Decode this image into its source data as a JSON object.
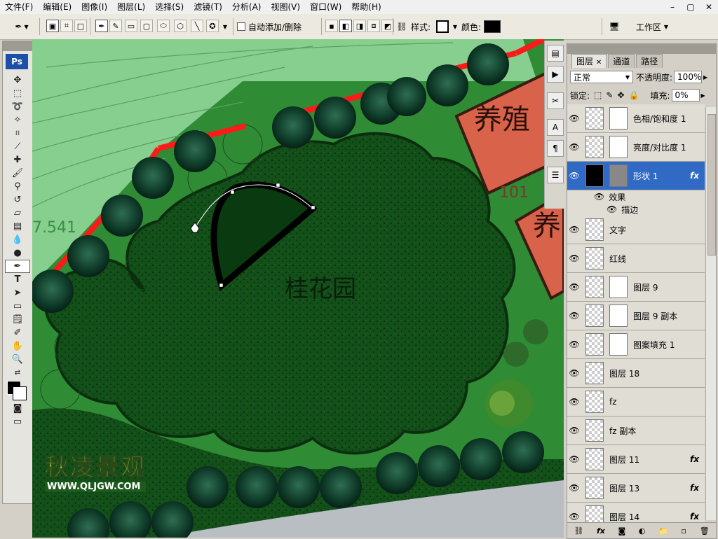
{
  "menubar": {
    "items": [
      "文件(F)",
      "编辑(E)",
      "图像(I)",
      "图层(L)",
      "选择(S)",
      "滤镜(T)",
      "分析(A)",
      "视图(V)",
      "窗口(W)",
      "帮助(H)"
    ],
    "window_controls": [
      "–",
      "▢",
      "✕"
    ]
  },
  "options": {
    "auto_add_delete_label": "自动添加/删除",
    "style_label": "样式:",
    "color_label": "颜色:",
    "workspace_label": "工作区",
    "color_value": "#000000"
  },
  "toolbox": {
    "logo": "Ps"
  },
  "canvas": {
    "title_text": "桂花园",
    "label_right_top": "养殖",
    "label_right_mid": "养",
    "num_left": "7.541",
    "num_right": "101"
  },
  "watermark": {
    "brand": "秋凌景观",
    "url": "WWW.QLJGW.COM"
  },
  "layers_panel": {
    "tabs": [
      "图层",
      "通道",
      "路径"
    ],
    "blend_mode": "正常",
    "opacity_label": "不透明度:",
    "opacity_value": "100%",
    "lock_label": "锁定:",
    "fill_label": "填充:",
    "fill_value": "0%",
    "effects_label": "效果",
    "stroke_label": "描边",
    "fx_label": "fx",
    "layers": [
      {
        "name": "色相/饱和度 1",
        "thumb": "adj",
        "mask": true,
        "fx": false,
        "selected": false
      },
      {
        "name": "亮度/对比度 1",
        "thumb": "adj",
        "mask": true,
        "fx": false,
        "selected": false
      },
      {
        "name": "形状 1",
        "thumb": "dark",
        "mask": true,
        "fx": true,
        "selected": true
      },
      {
        "name": "文字",
        "thumb": "check",
        "mask": false,
        "fx": false,
        "selected": false
      },
      {
        "name": "红线",
        "thumb": "check",
        "mask": false,
        "fx": false,
        "selected": false
      },
      {
        "name": "图层 9",
        "thumb": "check",
        "mask": true,
        "fx": false,
        "selected": false
      },
      {
        "name": "图层 9 副本",
        "thumb": "check",
        "mask": true,
        "fx": false,
        "selected": false
      },
      {
        "name": "图案填充 1",
        "thumb": "check",
        "mask": true,
        "fx": false,
        "selected": false
      },
      {
        "name": "图层 18",
        "thumb": "check",
        "mask": false,
        "fx": false,
        "selected": false
      },
      {
        "name": "fz",
        "thumb": "check",
        "mask": false,
        "fx": false,
        "selected": false
      },
      {
        "name": "fz 副本",
        "thumb": "check",
        "mask": false,
        "fx": false,
        "selected": false
      },
      {
        "name": "图层 11",
        "thumb": "check",
        "mask": false,
        "fx": true,
        "selected": false
      },
      {
        "name": "图层 13",
        "thumb": "check",
        "mask": false,
        "fx": true,
        "selected": false
      },
      {
        "name": "图层 14",
        "thumb": "check",
        "mask": false,
        "fx": true,
        "selected": false
      }
    ]
  }
}
